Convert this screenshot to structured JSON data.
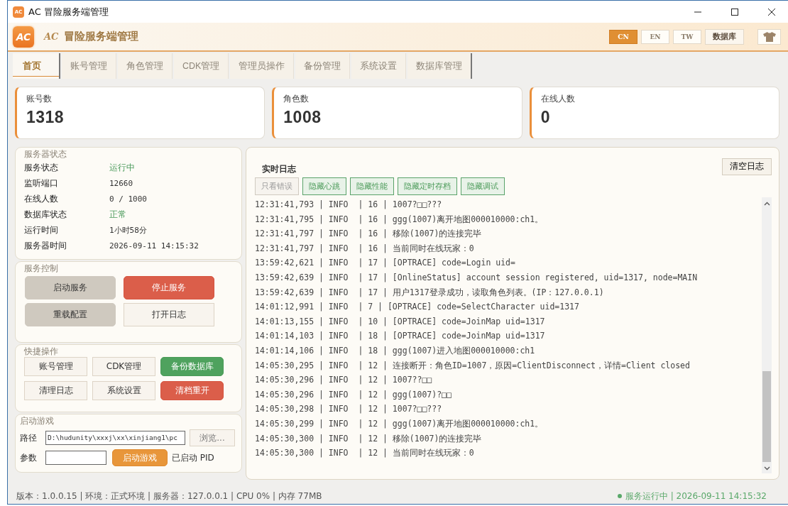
{
  "window": {
    "title": "AC 冒险服务端管理",
    "icon_text": "AC"
  },
  "header": {
    "logo": "AC",
    "title_prefix": "AC",
    "title": "冒险服务端管理",
    "languages": [
      {
        "label": "CN",
        "selected": true
      },
      {
        "label": "EN",
        "selected": false
      },
      {
        "label": "TW",
        "selected": false
      }
    ],
    "db_button": "数据库"
  },
  "tabs": [
    {
      "label": "首页",
      "selected": true
    },
    {
      "label": "账号管理",
      "selected": false
    },
    {
      "label": "角色管理",
      "selected": false
    },
    {
      "label": "CDK管理",
      "selected": false
    },
    {
      "label": "管理员操作",
      "selected": false
    },
    {
      "label": "备份管理",
      "selected": false
    },
    {
      "label": "系统设置",
      "selected": false
    },
    {
      "label": "数据库管理",
      "selected": false
    }
  ],
  "stats": [
    {
      "label": "账号数",
      "value": "1318"
    },
    {
      "label": "角色数",
      "value": "1008"
    },
    {
      "label": "在线人数",
      "value": "0"
    }
  ],
  "server_status": {
    "title": "服务器状态",
    "rows": [
      {
        "label": "服务状态",
        "value": "运行中",
        "kind": "good"
      },
      {
        "label": "监听端口",
        "value": "12660",
        "kind": "plain"
      },
      {
        "label": "在线人数",
        "value": "0 / 1000",
        "kind": "plain"
      },
      {
        "label": "数据库状态",
        "value": "正常",
        "kind": "good"
      },
      {
        "label": "运行时间",
        "value": "1小时58分",
        "kind": "plain"
      },
      {
        "label": "服务器时间",
        "value": "2026-09-11 14:15:32",
        "kind": "plain"
      }
    ]
  },
  "service_control": {
    "title": "服务控制",
    "buttons": [
      {
        "label": "启动服务",
        "kind": "muted"
      },
      {
        "label": "停止服务",
        "kind": "danger"
      },
      {
        "label": "重载配置",
        "kind": "muted"
      },
      {
        "label": "打开日志",
        "kind": "plain"
      }
    ]
  },
  "quick_actions": {
    "title": "快捷操作",
    "buttons": [
      {
        "label": "账号管理",
        "kind": "plain"
      },
      {
        "label": "CDK管理",
        "kind": "plain"
      },
      {
        "label": "备份数据库",
        "kind": "success"
      },
      {
        "label": "清理日志",
        "kind": "plain"
      },
      {
        "label": "系统设置",
        "kind": "plain"
      },
      {
        "label": "清档重开",
        "kind": "danger"
      }
    ]
  },
  "launch": {
    "title": "启动游戏",
    "path_label": "路径",
    "path_value": "D:\\hudunity\\xxxj\\xx\\xinjiang1\\pc",
    "browse": "浏览...",
    "args_label": "参数",
    "start": "启动游戏",
    "pid_label": "已启动 PID"
  },
  "log": {
    "title": "实时日志",
    "clear": "清空日志",
    "filters": [
      {
        "label": "只看错误",
        "on": false
      },
      {
        "label": "隐藏心跳",
        "on": true
      },
      {
        "label": "隐藏性能",
        "on": true
      },
      {
        "label": "隐藏定时存档",
        "on": true
      },
      {
        "label": "隐藏调试",
        "on": true
      }
    ],
    "lines": [
      "12:31:41,793 | INFO  | 16 | 1007?□□???",
      "12:31:41,795 | INFO  | 16 | ggg(1007)离开地图000010000:ch1。",
      "12:31:41,797 | INFO  | 16 | 移除(1007)的连接完毕",
      "12:31:41,797 | INFO  | 16 | 当前同时在线玩家：0",
      "13:59:42,621 | INFO  | 17 | [OPTRACE] code=Login uid=",
      "13:59:42,639 | INFO  | 17 | [OnlineStatus] account session registered, uid=1317, node=MAIN",
      "13:59:42,639 | INFO  | 17 | 用户1317登录成功，读取角色列表。(IP：127.0.0.1)",
      "14:01:12,991 | INFO  | 7 | [OPTRACE] code=SelectCharacter uid=1317",
      "14:01:13,155 | INFO  | 10 | [OPTRACE] code=JoinMap uid=1317",
      "14:01:14,103 | INFO  | 18 | [OPTRACE] code=JoinMap uid=1317",
      "14:01:14,106 | INFO  | 18 | ggg(1007)进入地图000010000:ch1",
      "14:05:30,295 | INFO  | 12 | 连接断开：角色ID=1007，原因=ClientDisconnect，详情=Client closed",
      "14:05:30,296 | INFO  | 12 | 1007??□□",
      "14:05:30,296 | INFO  | 12 | ggg(1007)?□□",
      "14:05:30,298 | INFO  | 12 | 1007?□□???",
      "14:05:30,299 | INFO  | 12 | ggg(1007)离开地图000010000:ch1。",
      "14:05:30,300 | INFO  | 12 | 移除(1007)的连接完毕",
      "14:05:30,300 | INFO  | 12 | 当前同时在线玩家：0"
    ]
  },
  "status_bar": {
    "left": "版本：1.0.0.15 | 环境：正式环境 | 服务器：127.0.0.1 | CPU 0% | 内存 77MB",
    "right": "服务运行中 | 2026-09-11 14:15:32"
  }
}
